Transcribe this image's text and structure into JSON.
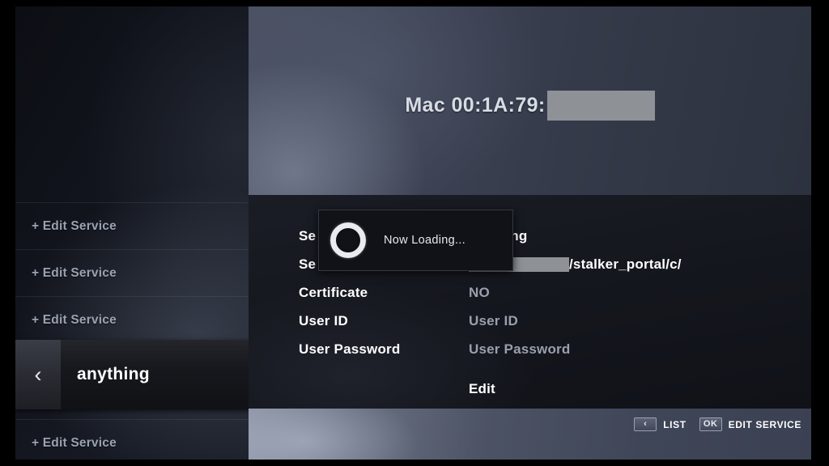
{
  "banner": {
    "mac_label": "Mac 00:1A:79:",
    "mac_redacted": ""
  },
  "sidebar": {
    "items": [
      {
        "label": "+ Edit Service"
      },
      {
        "label": "+ Edit Service"
      },
      {
        "label": "+ Edit Service"
      },
      {
        "label": "+ Edit Service"
      }
    ],
    "selected": {
      "chevron": "‹",
      "label": "anything",
      "icon": "monitor-icon"
    }
  },
  "dialog": {
    "text": "Now Loading...",
    "spinner": "ring-spinner"
  },
  "form": {
    "rows": [
      {
        "label": "Se",
        "value": "anything",
        "value_style": "strong"
      },
      {
        "label": "Se",
        "value": "/stalker_portal/c/",
        "value_style": "strong",
        "redacted_prefix": true
      },
      {
        "label": "Certificate",
        "value": "NO",
        "value_style": "dim"
      },
      {
        "label": "User ID",
        "value": "User ID",
        "value_style": "dim"
      },
      {
        "label": "User Password",
        "value": "User Password",
        "value_style": "dim"
      }
    ],
    "edit_action": "Edit"
  },
  "hints": [
    {
      "key": "‹",
      "text": "LIST"
    },
    {
      "key": "OK",
      "text": "EDIT SERVICE"
    }
  ],
  "colors": {
    "banner_blue": "#3d4354",
    "redaction_gray": "#8e9196",
    "accent_white": "#ffffff",
    "dim_text": "#99a0ad",
    "sidebar_text": "#9aa2b2"
  }
}
